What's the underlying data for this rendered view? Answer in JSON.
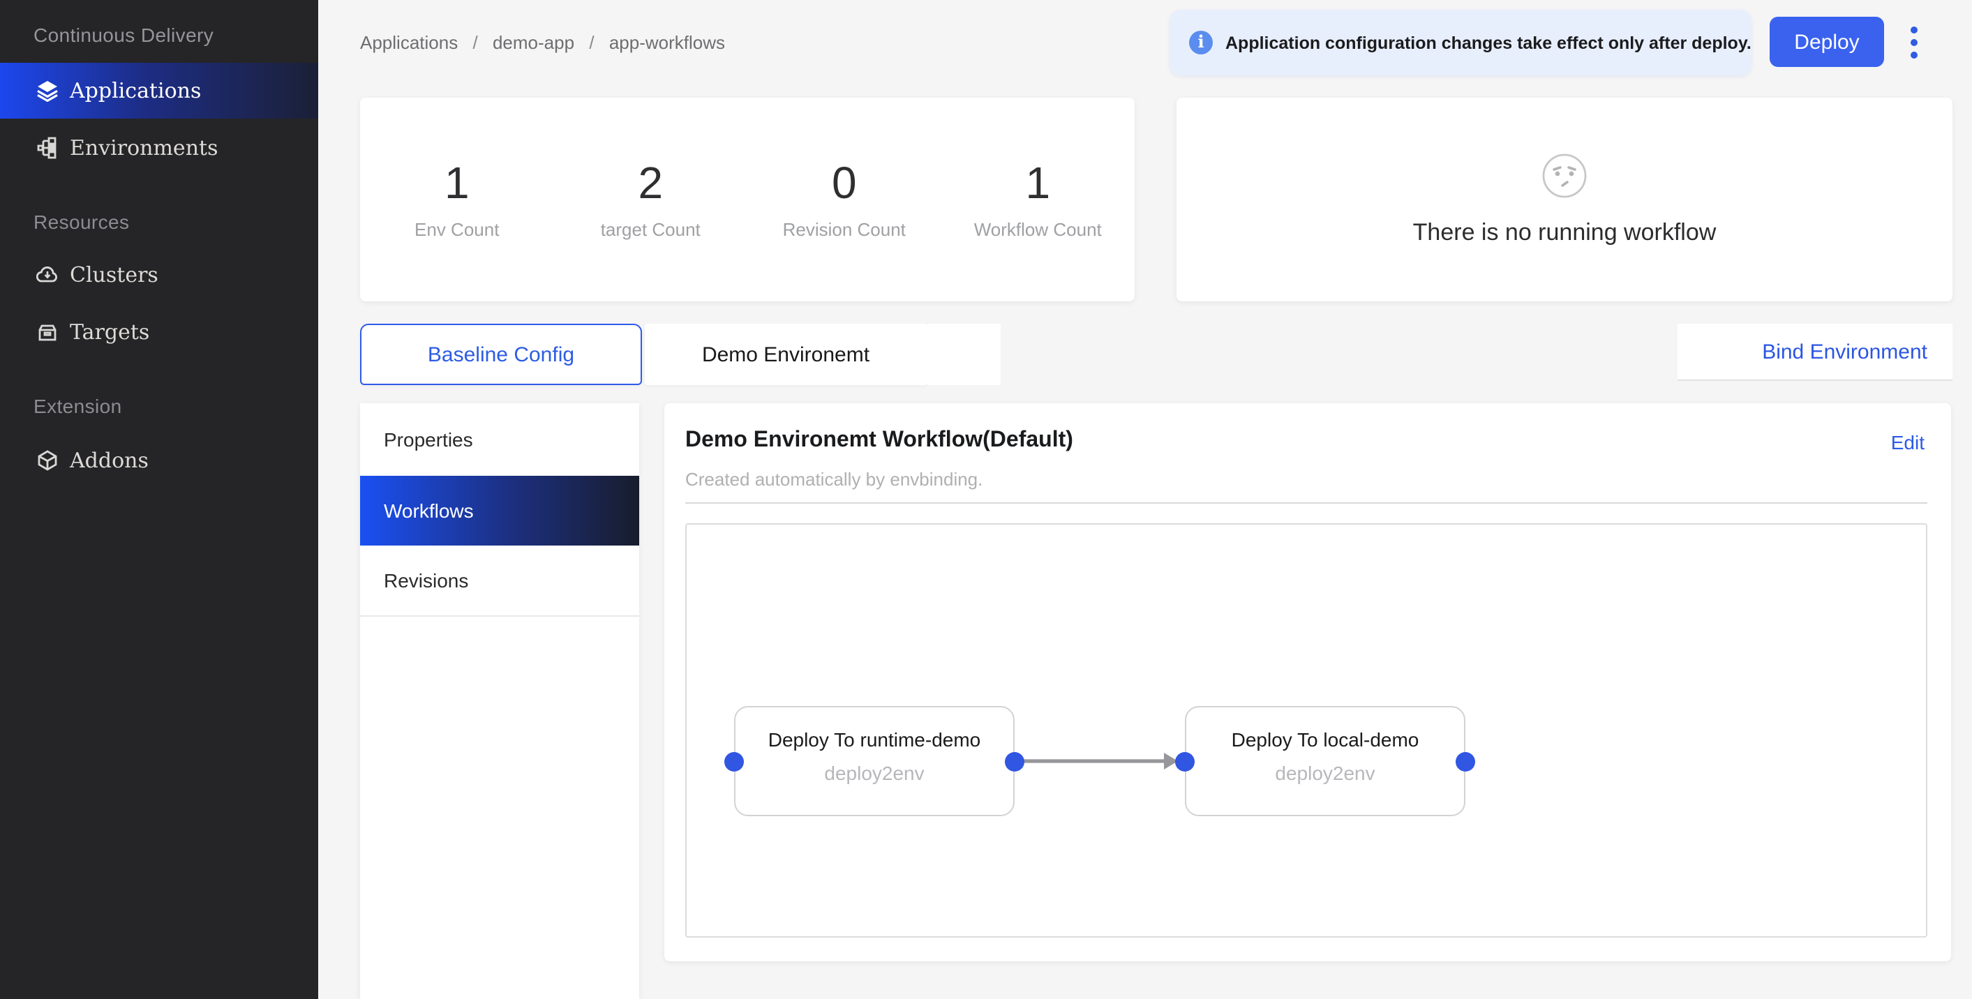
{
  "sidebar": {
    "title": "Continuous Delivery",
    "sections": [
      {
        "label": "",
        "items": [
          {
            "label": "Applications",
            "icon": "layers-icon",
            "active": true
          },
          {
            "label": "Environments",
            "icon": "topology-icon",
            "active": false
          }
        ]
      },
      {
        "label": "Resources",
        "items": [
          {
            "label": "Clusters",
            "icon": "cloud-icon",
            "active": false
          },
          {
            "label": "Targets",
            "icon": "archive-icon",
            "active": false
          }
        ]
      },
      {
        "label": "Extension",
        "items": [
          {
            "label": "Addons",
            "icon": "cube-icon",
            "active": false
          }
        ]
      }
    ]
  },
  "header": {
    "breadcrumb": [
      "Applications",
      "demo-app",
      "app-workflows"
    ],
    "alert_message": "Application configuration changes take effect only after deploy.",
    "alert_icon": "info-icon",
    "deploy_label": "Deploy",
    "more_menu_icon": "kebab-menu-icon"
  },
  "stats": {
    "items": [
      {
        "value": "1",
        "label": "Env Count"
      },
      {
        "value": "2",
        "label": "target Count"
      },
      {
        "value": "0",
        "label": "Revision Count"
      },
      {
        "value": "1",
        "label": "Workflow Count"
      }
    ]
  },
  "workflow_status": {
    "icon": "worried-face-icon",
    "empty_message": "There is no running workflow"
  },
  "tabs": {
    "items": [
      {
        "label": "Baseline Config",
        "active": true
      },
      {
        "label": "Demo Environemt",
        "active": false
      }
    ],
    "bind_environment_label": "Bind Environment"
  },
  "menu": {
    "items": [
      "Properties",
      "Workflows",
      "Revisions"
    ],
    "active_item": "Workflows"
  },
  "panel": {
    "title": "Demo Environemt Workflow(Default)",
    "edit_label": "Edit",
    "subtitle": "Created automatically by envbinding.",
    "nodes": [
      {
        "title": "Deploy To runtime-demo",
        "subtitle": "deploy2env"
      },
      {
        "title": "Deploy To local-demo",
        "subtitle": "deploy2env"
      }
    ]
  },
  "colors": {
    "accent_blue": "#2d5ce6",
    "deploy_button": "#3a62ee",
    "alert_background": "#e8effc",
    "sidebar_background": "#252527",
    "selected_gradient_start": "#1d47ee",
    "selected_gradient_end": "#1b2036",
    "page_background": "#f5f5f6",
    "port_blue": "#3056e2",
    "connector_gray": "#97979b"
  }
}
